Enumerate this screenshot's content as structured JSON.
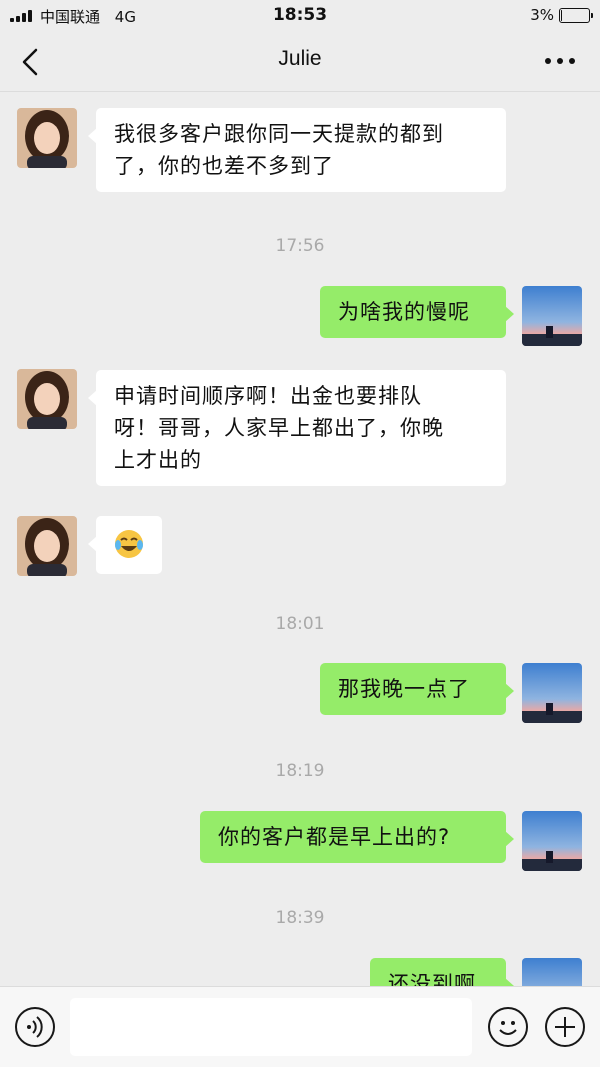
{
  "status_bar": {
    "carrier": "中国联通",
    "network": "4G",
    "time": "18:53",
    "battery": "3%",
    "battery_level": 0.03
  },
  "header": {
    "title": "Julie",
    "back_icon": "chevron-left-icon",
    "more_icon": "more-dots-icon"
  },
  "messages": [
    {
      "side": "in",
      "text_line1": "我很多客户跟你同一天提款的都到",
      "text_line2": "了，你的也差不多到了"
    },
    {
      "type": "time",
      "text": "17:56"
    },
    {
      "side": "out",
      "text": "为啥我的慢呢"
    },
    {
      "side": "in",
      "text_line1": "申请时间顺序啊！出金也要排队",
      "text_line2": "呀！哥哥，人家早上都出了，你晚",
      "text_line3": "上才出的"
    },
    {
      "side": "in",
      "emoji": "tears-of-joy-emoji"
    },
    {
      "type": "time",
      "text": "18:01"
    },
    {
      "side": "out",
      "text": "那我晚一点了"
    },
    {
      "type": "time",
      "text": "18:19"
    },
    {
      "side": "out",
      "text": "你的客户都是早上出的?"
    },
    {
      "type": "time",
      "text": "18:39"
    },
    {
      "side": "out",
      "text": "还没到啊"
    }
  ],
  "input_bar": {
    "voice_icon": "voice-icon",
    "emoji_icon": "emoji-icon",
    "plus_icon": "plus-icon",
    "text_value": ""
  },
  "colors": {
    "background": "#ededed",
    "outgoing_bubble": "#95ec69",
    "incoming_bubble": "#ffffff",
    "timestamp": "#a9a9a9"
  }
}
